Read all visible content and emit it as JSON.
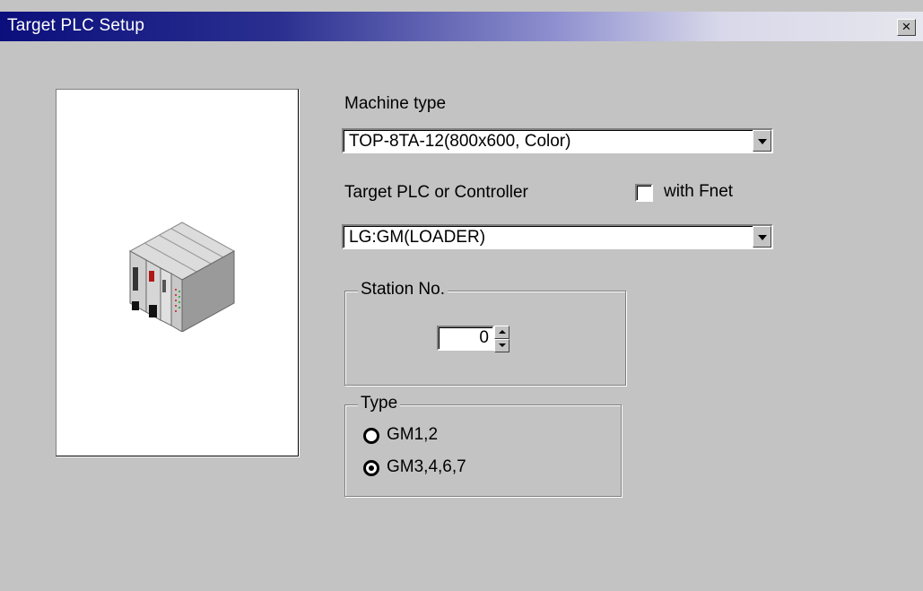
{
  "window": {
    "title": "Target PLC Setup",
    "close_label": "×"
  },
  "machine_type": {
    "label": "Machine type",
    "value": "TOP-8TA-12(800x600, Color)"
  },
  "target_plc": {
    "label": "Target PLC or Controller",
    "value": "LG:GM(LOADER)"
  },
  "with_fnet": {
    "label": "with Fnet",
    "checked": false
  },
  "station": {
    "legend": "Station No.",
    "value": "0"
  },
  "type_group": {
    "legend": "Type",
    "options": [
      {
        "label": "GM1,2",
        "selected": false
      },
      {
        "label": "GM3,4,6,7",
        "selected": true
      }
    ]
  },
  "image": {
    "icon": "plc-rack-icon"
  }
}
